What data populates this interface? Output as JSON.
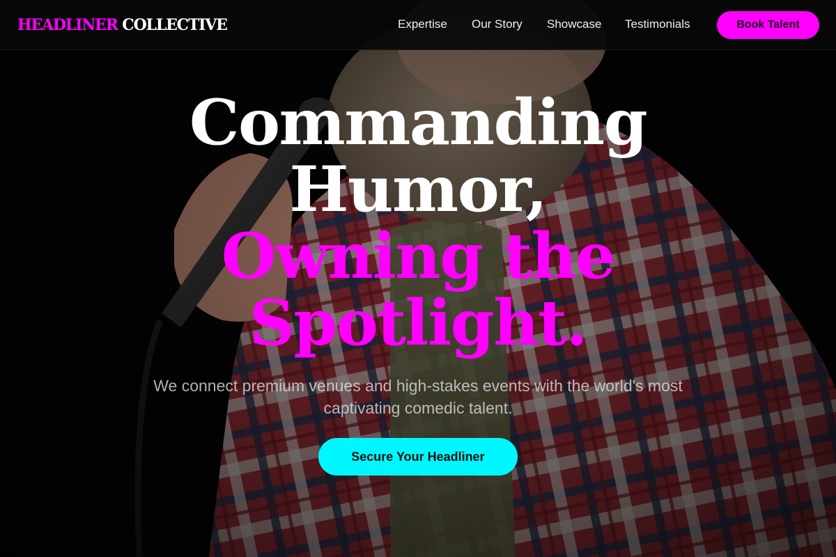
{
  "brand": {
    "name_highlight": "HEADLINER",
    "name_rest": " COLLECTIVE",
    "accent_color": "#ff00ff",
    "cta_color": "#00f7ff"
  },
  "nav": {
    "links": [
      "Expertise",
      "Our Story",
      "Showcase",
      "Testimonials"
    ],
    "book_label": "Book Talent"
  },
  "hero": {
    "headline_line1": "Commanding",
    "headline_line2": "Humor,",
    "headline_line3": "Owning the",
    "headline_line4": "Spotlight.",
    "subtext": "We connect premium venues and high-stakes events with the world's most captivating comedic talent.",
    "cta_label": "Secure Your Headliner",
    "background_image": "comedian-with-microphone-plaid-shirt"
  }
}
